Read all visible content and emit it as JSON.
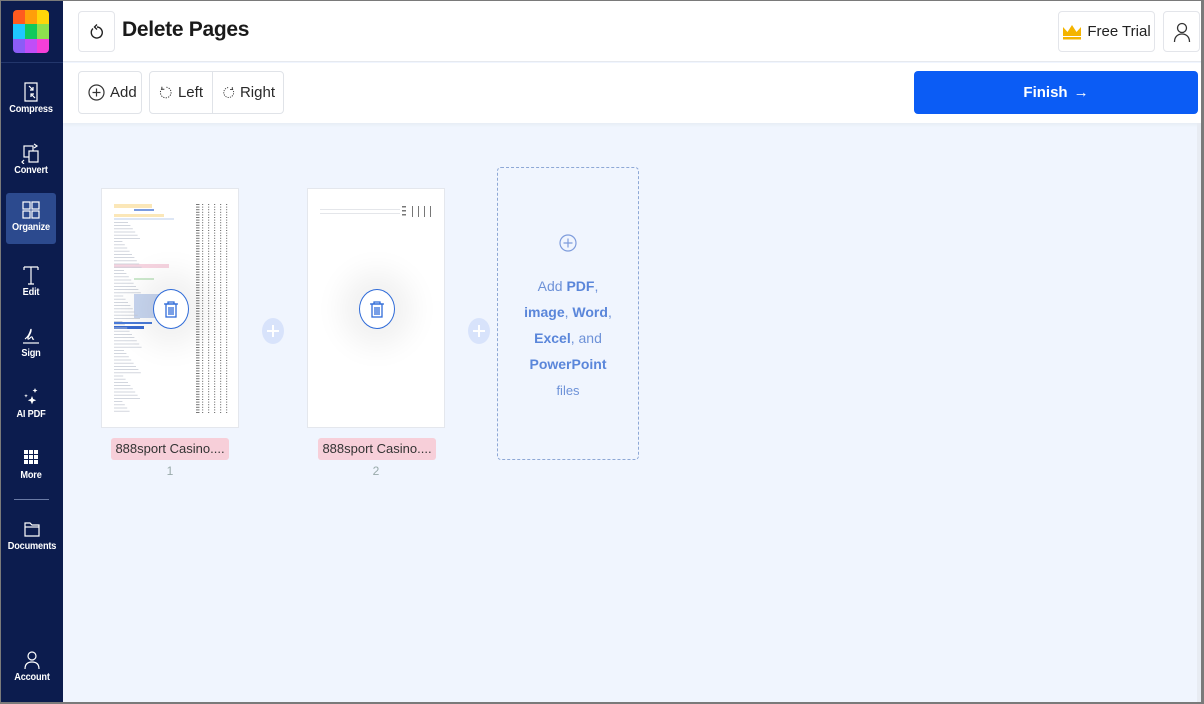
{
  "sidebar": {
    "items": [
      {
        "label": "Compress",
        "icon": "compress-icon",
        "active": false
      },
      {
        "label": "Convert",
        "icon": "convert-icon",
        "active": false
      },
      {
        "label": "Organize",
        "icon": "organize-icon",
        "active": true
      },
      {
        "label": "Edit",
        "icon": "edit-text-icon",
        "active": false
      },
      {
        "label": "Sign",
        "icon": "signature-icon",
        "active": false
      },
      {
        "label": "AI PDF",
        "icon": "sparkle-icon",
        "active": false
      },
      {
        "label": "More",
        "icon": "grid-dots-icon",
        "active": false
      },
      {
        "label": "Documents",
        "icon": "folder-icon",
        "active": false
      },
      {
        "label": "Account",
        "icon": "user-icon",
        "active": false
      }
    ],
    "logo_colors": [
      "#ff5a1f",
      "#ff9f0a",
      "#ffd60a",
      "#1ec8ff",
      "#10c95c",
      "#8de04e",
      "#8b5cf6",
      "#c04ef7",
      "#f53fd8"
    ]
  },
  "header": {
    "title": "Delete Pages",
    "free_trial_label": "Free Trial",
    "crown_color": "#f4b400"
  },
  "toolbar": {
    "add_label": "Add",
    "rotate_left_label": "Left",
    "rotate_right_label": "Right",
    "finish_label": "Finish",
    "finish_arrow": "→",
    "accent_color": "#0b5cf5"
  },
  "pages": [
    {
      "filename": "888sport Casino....",
      "number": "1"
    },
    {
      "filename": "888sport Casino....",
      "number": "2"
    }
  ],
  "dropzone": {
    "add": "Add ",
    "pdf": "PDF",
    "comma1": ",",
    "image": "image",
    "comma2": ", ",
    "word": "Word",
    "comma3": ",",
    "excel": "Excel",
    "and": ", and",
    "powerpoint": "PowerPoint",
    "files": "files"
  }
}
